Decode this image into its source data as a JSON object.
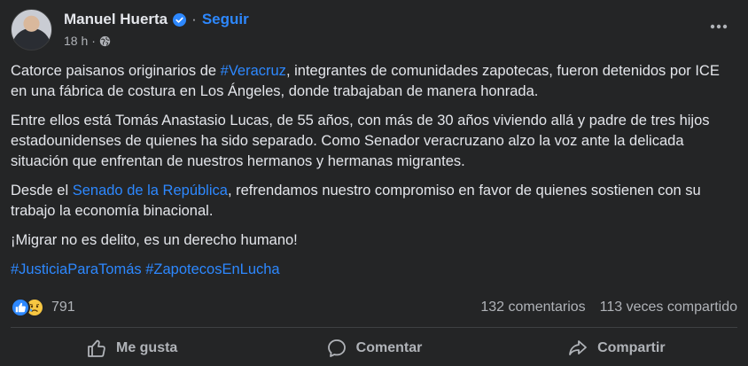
{
  "post": {
    "author": "Manuel Huerta",
    "separator": "·",
    "follow_label": "Seguir",
    "time": "18 h",
    "time_separator": "·",
    "paragraph1": {
      "prefix": "Catorce paisanos originarios de ",
      "hashtag": "#Veracruz",
      "suffix": ", integrantes de comunidades zapotecas, fueron detenidos por ICE en una fábrica de costura en Los Ángeles, donde trabajaban de manera honrada."
    },
    "paragraph2": "Entre ellos está Tomás Anastasio Lucas, de 55 años, con más de 30 años viviendo allá y padre de tres hijos estadounidenses de quienes ha sido separado. Como Senador veracruzano alzo la voz ante la delicada situación que enfrentan de nuestros hermanos y hermanas migrantes.",
    "paragraph3": {
      "prefix": "Desde el ",
      "link": "Senado de la República",
      "suffix": ", refrendamos nuestro compromiso en favor de quienes sostienen con su trabajo la economía binacional."
    },
    "paragraph4": "¡Migrar no es delito, es un derecho humano!",
    "hashtags": [
      "#JusticiaParaTomás",
      "#ZapotecosEnLucha"
    ]
  },
  "engagement": {
    "reaction_count": "791",
    "comments": "132 comentarios",
    "shares": "113 veces compartido"
  },
  "actions": {
    "like": "Me gusta",
    "comment": "Comentar",
    "share": "Compartir"
  },
  "icons": {
    "verified": "verified-badge-icon",
    "globe": "globe-icon",
    "more": "more-options-icon",
    "like_reaction": "like-reaction-icon",
    "sad_reaction": "sad-reaction-icon"
  },
  "colors": {
    "background": "#242526",
    "text": "#e4e6eb",
    "secondary_text": "#b0b3b8",
    "link": "#2d88ff"
  }
}
